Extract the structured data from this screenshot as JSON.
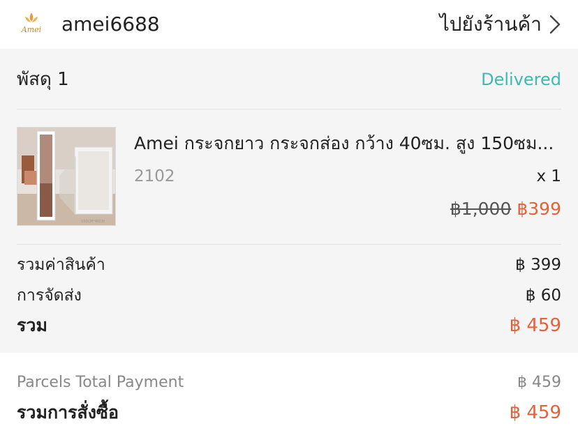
{
  "header": {
    "shop_name": "amei6688",
    "go_to_shop": "ไปยังร้านค้า",
    "logo_text": "Amei"
  },
  "parcel": {
    "title": "พัสดุ 1",
    "status": "Delivered",
    "item": {
      "name": "Amei กระจกยาว กระจกส่อง กว้าง 40ซม. สูง 150ซม...",
      "variant": "2102",
      "quantity": "x 1",
      "original_price": "฿1,000",
      "price": "฿399"
    },
    "subtotal_label": "รวมค่าสินค้า",
    "subtotal_value": "฿ 399",
    "shipping_label": "การจัดส่ง",
    "shipping_value": "฿ 60",
    "total_label": "รวม",
    "total_value": "฿ 459"
  },
  "summary": {
    "parcels_total_label": "Parcels Total Payment",
    "parcels_total_value": "฿ 459",
    "order_total_label": "รวมการสั่งซื้อ",
    "order_total_value": "฿ 459"
  },
  "colors": {
    "accent": "#e2633b",
    "status": "#3fbab0",
    "section_bg": "#f5f5f5"
  }
}
